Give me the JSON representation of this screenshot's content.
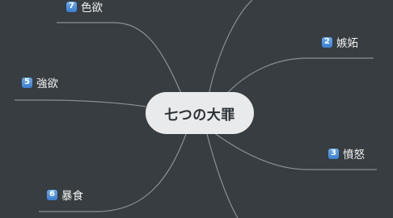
{
  "root": {
    "label": "七つの大罪"
  },
  "nodes": [
    {
      "id": "n7",
      "badge": "7",
      "label": "色欲"
    },
    {
      "id": "n2",
      "badge": "2",
      "label": "嫉妬"
    },
    {
      "id": "n5",
      "badge": "5",
      "label": "強欲"
    },
    {
      "id": "n3",
      "badge": "3",
      "label": "憤怒"
    },
    {
      "id": "n6",
      "badge": "6",
      "label": "暴食"
    }
  ],
  "colors": {
    "background": "#373d41",
    "branch": "#8b8f93",
    "root_fill": "#e9eaeb",
    "badge": "#4a8fdc",
    "text": "#f2f2f2"
  }
}
